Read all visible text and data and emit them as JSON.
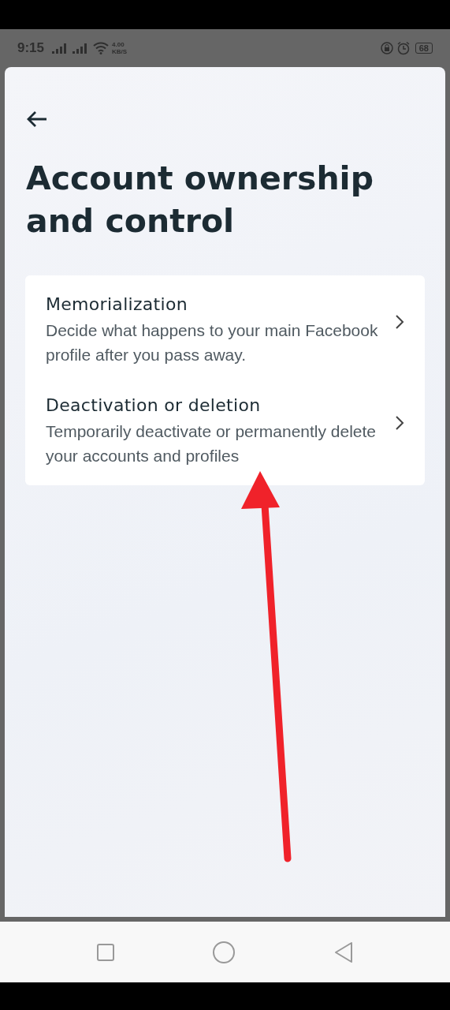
{
  "status_bar": {
    "time": "9:15",
    "speed_value": "4.00",
    "speed_unit": "KB/S",
    "battery": "68"
  },
  "title": "Account ownership and control",
  "items": [
    {
      "title": "Memorialization",
      "description": "Decide what happens to your main Facebook profile after you pass away."
    },
    {
      "title": "Deactivation or deletion",
      "description": "Temporarily deactivate or permanently delete your accounts and profiles"
    }
  ]
}
